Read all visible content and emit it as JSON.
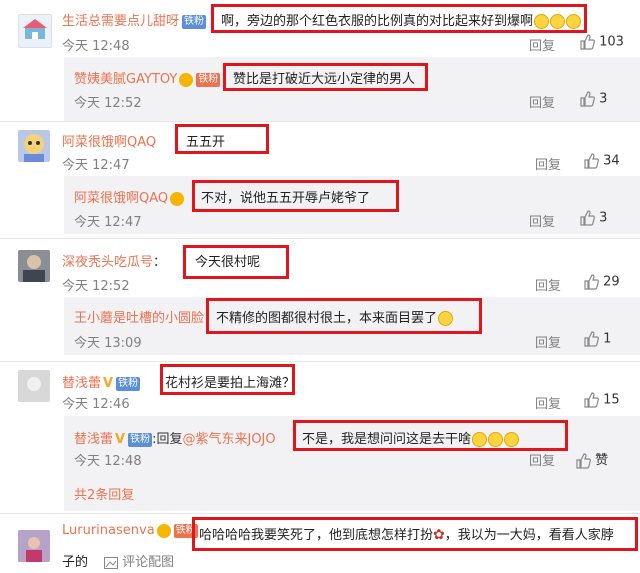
{
  "actions": {
    "reply": "回复",
    "comment_image": "评论配图"
  },
  "comments": [
    {
      "user": "生活总需要点儿甜呀",
      "badge": "铁粉",
      "text": "啊，旁边的那个红色衣服的比例真的对比起来好到爆啊",
      "time": "今天 12:48",
      "likes": "103",
      "reply": {
        "user": "赞姨美腻GAYTOY",
        "badge": "铁粉",
        "text": "赞比是打破近大远小定律的男人",
        "time": "今天 12:52",
        "likes": "3"
      }
    },
    {
      "user": "阿菜很饿啊QAQ",
      "text": "五五开",
      "time": "今天 12:47",
      "likes": "34",
      "reply": {
        "user": "阿菜很饿啊QAQ",
        "text": "不对，说他五五开辱卢姥爷了",
        "time": "今天 12:47",
        "likes": "3"
      }
    },
    {
      "user": "深夜秃头吃瓜号",
      "colon": "：",
      "text": "今天很村呢",
      "time": "今天 12:52",
      "likes": "29",
      "reply": {
        "user": "王小蘑是吐槽的小圆脸",
        "text": "不精修的图都很村很土，本来面目罢了",
        "time": "今天 13:09",
        "likes": "1"
      }
    },
    {
      "user": "替浅蕾",
      "badge": "铁粉",
      "text": "花村衫是要拍上海滩？",
      "time": "今天 12:46",
      "likes": "15",
      "reply": {
        "user": "替浅蕾",
        "badge": "铁粉",
        "reply_prefix": "回复",
        "reply_to": "@紫气东来JOJO",
        "text": "不是，我是想问问这是去干啥",
        "time": "今天 12:48",
        "likes": "赞"
      },
      "more_replies": "共2条回复"
    },
    {
      "user": "Lururinasenva",
      "badge": "铁粉",
      "text": "哈哈哈哈我要笑死了，他到底想怎样打扮",
      "text2": "，我以为一大妈，看看人家脖",
      "text3": "子的"
    }
  ],
  "colors": {
    "name": "#eb7350",
    "highlight": "#e0161d",
    "reply_bg": "#f2f2f5"
  }
}
